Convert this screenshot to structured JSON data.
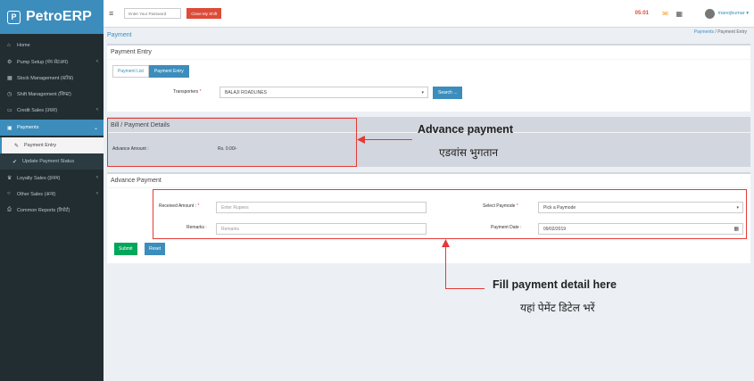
{
  "sidebar": {
    "logo_badge": "P",
    "logo_text": "PetroERP",
    "items": [
      {
        "label": "Home",
        "icon": "home-icon"
      },
      {
        "label": "Pump Setup (पंप सेटअप)",
        "icon": "gears-icon"
      },
      {
        "label": "Stock Management (स्टॉक)",
        "icon": "cubes-icon"
      },
      {
        "label": "Shift Management (शिफ्ट)",
        "icon": "clock-icon"
      },
      {
        "label": "Credit Sales (उधार)",
        "icon": "credit-card-icon"
      },
      {
        "label": "Payments",
        "icon": "money-icon"
      },
      {
        "label": "Payment Entry",
        "icon": "edit-icon"
      },
      {
        "label": "Update Payment Status",
        "icon": "check-icon"
      },
      {
        "label": "Loyalty Sales (इनाम)",
        "icon": "trophy-icon"
      },
      {
        "label": "Other Sales (अन्य)",
        "icon": "circle-icon"
      },
      {
        "label": "Common Reports (रिपोर्ट)",
        "icon": "print-icon"
      }
    ]
  },
  "header": {
    "password_placeholder": "Enter Your Password",
    "close_shift_label": "Close My Shift",
    "timer": "05:01",
    "username": "manojkumar"
  },
  "content": {
    "page_title": "Payment",
    "breadcrumb": {
      "link": "Payments",
      "current": "Payment Entry"
    }
  },
  "payment_entry": {
    "title": "Payment Entry",
    "tabs": [
      "Payment List",
      "Payment Entry"
    ],
    "transporters_label": "Transporters",
    "transporter_value": "BALAJI ROADLINES",
    "search_label": "Search ..."
  },
  "bill_details": {
    "title": "Bill / Payment Details",
    "advance_label": "Advance Amount :",
    "advance_value": "Rs. 0.00/-"
  },
  "annotations": {
    "advance_title": "Advance payment",
    "advance_sub": "एडवांस भुगतान",
    "fill_title": "Fill payment detail here",
    "fill_sub": "यहां पेमेंट डिटेल भरें"
  },
  "advance_payment": {
    "title": "Advance Payment",
    "received_label": "Received Amount :",
    "received_placeholder": "Enter Rupees",
    "remarks_label": "Remarks :",
    "remarks_placeholder": "Remarks",
    "paymode_label": "Select Paymode",
    "paymode_value": "Pick a Paymode",
    "date_label": "Payment Date :",
    "date_value": "09/02/2019",
    "submit_label": "Submit",
    "reset_label": "Reset"
  },
  "colors": {
    "primary": "#3c8dbc",
    "sidebar": "#222d32",
    "danger": "#dd4b39",
    "success": "#00a65a",
    "annotation": "#e53935"
  }
}
